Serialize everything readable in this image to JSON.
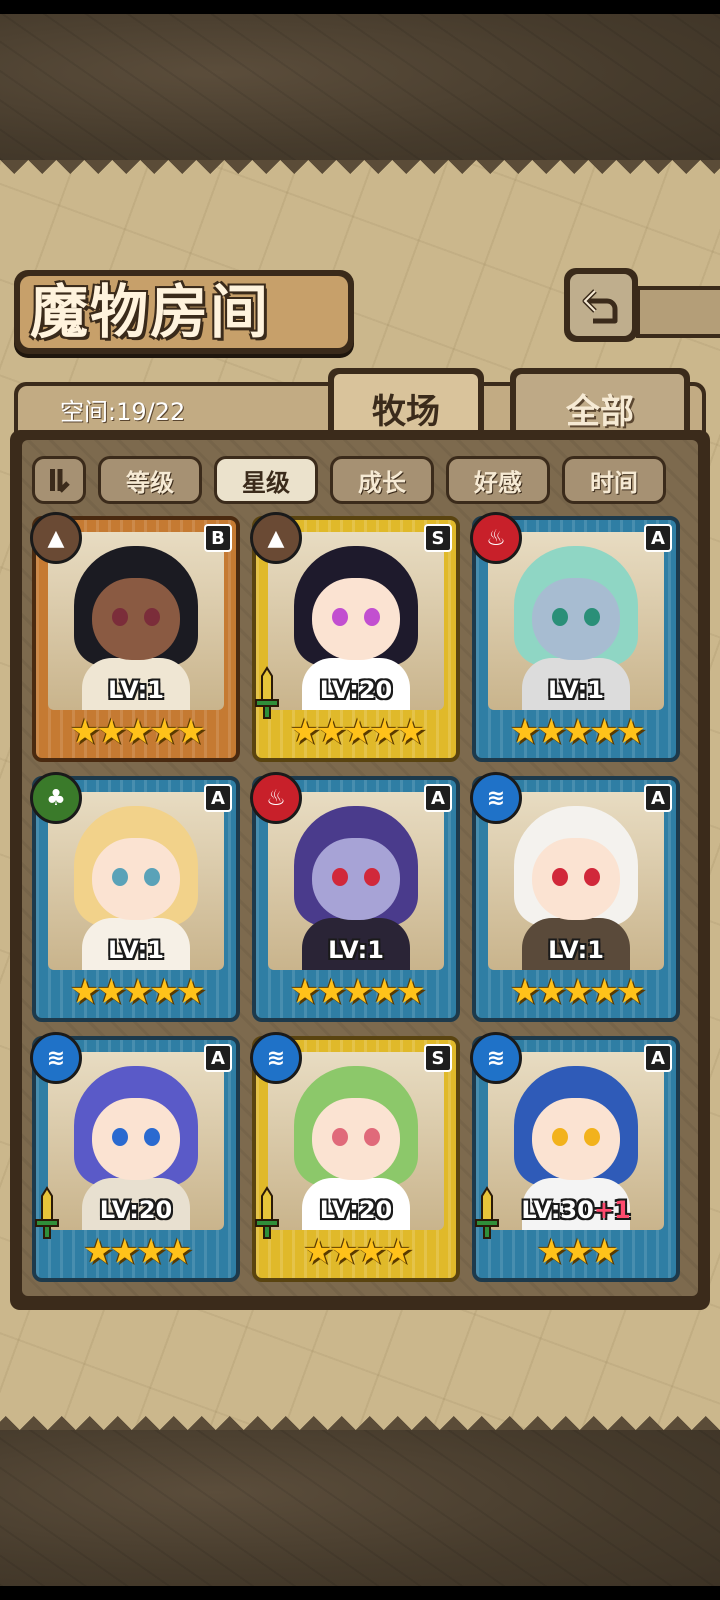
{
  "header": {
    "title": "魔物房间",
    "back_icon": "return-arrow-icon"
  },
  "tabs": {
    "space_label": "空间:19/22",
    "items": [
      {
        "label": "牧场",
        "active": true
      },
      {
        "label": "全部",
        "active": false
      }
    ]
  },
  "sort": {
    "toggle_icon": "sort-order-icon",
    "options": [
      {
        "label": "等级",
        "active": false
      },
      {
        "label": "星级",
        "active": true
      },
      {
        "label": "成长",
        "active": false
      },
      {
        "label": "好感",
        "active": false
      },
      {
        "label": "时间",
        "active": false
      }
    ]
  },
  "monsters": [
    {
      "level": "LV:1",
      "plus": "",
      "rank": "B",
      "element": "earth",
      "element_icon": "earth-element-icon",
      "frame": "bronze",
      "stars": 5,
      "has_sword": false,
      "hair": "#1b1b22",
      "skin": "#8a5a42",
      "eye": "#7b2d3a",
      "outfit": "#efe6d3"
    },
    {
      "level": "LV:20",
      "plus": "",
      "rank": "S",
      "element": "earth",
      "element_icon": "earth-element-icon",
      "frame": "gold",
      "stars": 5,
      "has_sword": true,
      "hair": "#1e1a2c",
      "skin": "#fbe3d2",
      "eye": "#c24fd0",
      "outfit": "#ffffff"
    },
    {
      "level": "LV:1",
      "plus": "",
      "rank": "A",
      "element": "fire",
      "element_icon": "fire-element-icon",
      "frame": "blue",
      "stars": 5,
      "has_sword": false,
      "hair": "#8fd6c4",
      "skin": "#a7bcd1",
      "eye": "#2a8f78",
      "outfit": "#dcdcdc"
    },
    {
      "level": "LV:1",
      "plus": "",
      "rank": "A",
      "element": "wind",
      "element_icon": "leaf-element-icon",
      "frame": "blue",
      "stars": 5,
      "has_sword": false,
      "hair": "#f2d28a",
      "skin": "#fbe3d2",
      "eye": "#5aa2b8",
      "outfit": "#f6f0e6"
    },
    {
      "level": "LV:1",
      "plus": "",
      "rank": "A",
      "element": "fire",
      "element_icon": "fire-element-icon",
      "frame": "blue",
      "stars": 5,
      "has_sword": false,
      "hair": "#4a3b8c",
      "skin": "#a7a3d6",
      "eye": "#d1283a",
      "outfit": "#2a2436"
    },
    {
      "level": "LV:1",
      "plus": "",
      "rank": "A",
      "element": "water",
      "element_icon": "water-element-icon",
      "frame": "blue",
      "stars": 5,
      "has_sword": false,
      "hair": "#f4f2ee",
      "skin": "#fbe3d2",
      "eye": "#d1283a",
      "outfit": "#5a4a3a"
    },
    {
      "level": "LV:20",
      "plus": "",
      "rank": "A",
      "element": "water",
      "element_icon": "water-element-icon",
      "frame": "blue",
      "stars": 4,
      "has_sword": true,
      "hair": "#5a5ac8",
      "skin": "#fbe3d2",
      "eye": "#2a6ad0",
      "outfit": "#e8e0d0"
    },
    {
      "level": "LV:20",
      "plus": "",
      "rank": "S",
      "element": "water",
      "element_icon": "water-element-icon",
      "frame": "gold",
      "stars": 4,
      "has_sword": true,
      "hair": "#8cc86a",
      "skin": "#fbe3d2",
      "eye": "#e06a7a",
      "outfit": "#ffffff"
    },
    {
      "level": "LV:30",
      "plus": "+1",
      "rank": "A",
      "element": "water",
      "element_icon": "water-element-icon",
      "frame": "blue",
      "stars": 3,
      "has_sword": true,
      "hair": "#2f5bb8",
      "skin": "#fbe3d2",
      "eye": "#f2b21c",
      "outfit": "#f4f4f4"
    }
  ],
  "colors": {
    "parchment": "#cbb78c",
    "frame_dark": "#3b2b1b",
    "star": "#ffc21a",
    "element_fire": "#c8202a",
    "element_water": "#1f72c8",
    "element_earth": "#6a4a34",
    "element_wind": "#3a7a2a"
  }
}
